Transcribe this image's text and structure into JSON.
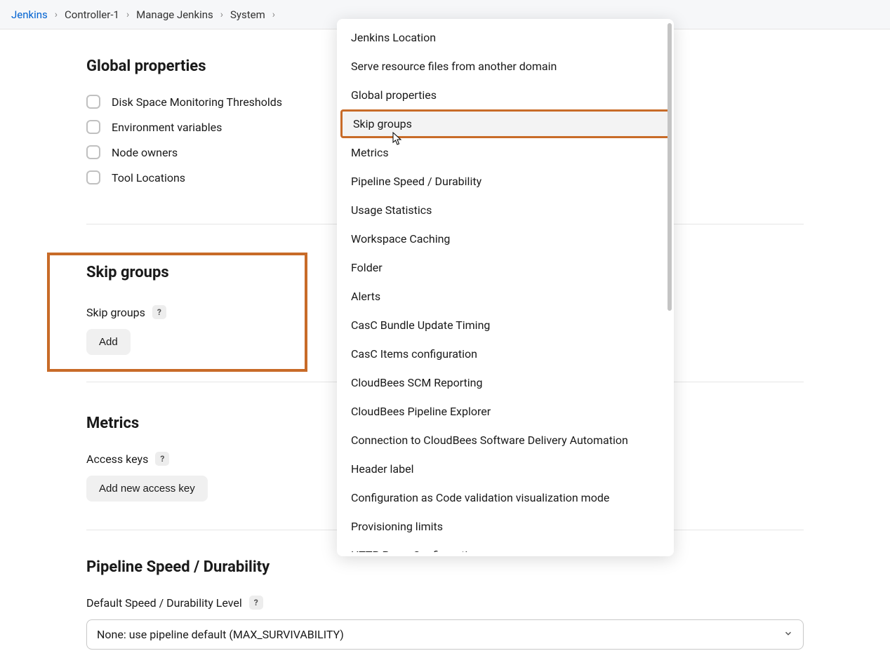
{
  "breadcrumb": {
    "items": [
      {
        "label": "Jenkins",
        "active": true
      },
      {
        "label": "Controller-1"
      },
      {
        "label": "Manage Jenkins"
      },
      {
        "label": "System"
      }
    ]
  },
  "sections": {
    "global": {
      "title": "Global properties",
      "checkboxes": [
        "Disk Space Monitoring Thresholds",
        "Environment variables",
        "Node owners",
        "Tool Locations"
      ]
    },
    "skip": {
      "title": "Skip groups",
      "field_label": "Skip groups",
      "add_label": "Add"
    },
    "metrics": {
      "title": "Metrics",
      "field_label": "Access keys",
      "add_label": "Add new access key"
    },
    "pipeline": {
      "title": "Pipeline Speed / Durability",
      "field_label": "Default Speed / Durability Level",
      "select_value": "None: use pipeline default (MAX_SURVIVABILITY)"
    }
  },
  "popover": {
    "highlighted_index": 3,
    "items": [
      "Jenkins Location",
      "Serve resource files from another domain",
      "Global properties",
      "Skip groups",
      "Metrics",
      "Pipeline Speed / Durability",
      "Usage Statistics",
      "Workspace Caching",
      "Folder",
      "Alerts",
      "CasC Bundle Update Timing",
      "CasC Items configuration",
      "CloudBees SCM Reporting",
      "CloudBees Pipeline Explorer",
      "Connection to CloudBees Software Delivery Automation",
      "Header label",
      "Configuration as Code validation visualization mode",
      "Provisioning limits",
      "HTTP Proxy Configuration"
    ]
  }
}
